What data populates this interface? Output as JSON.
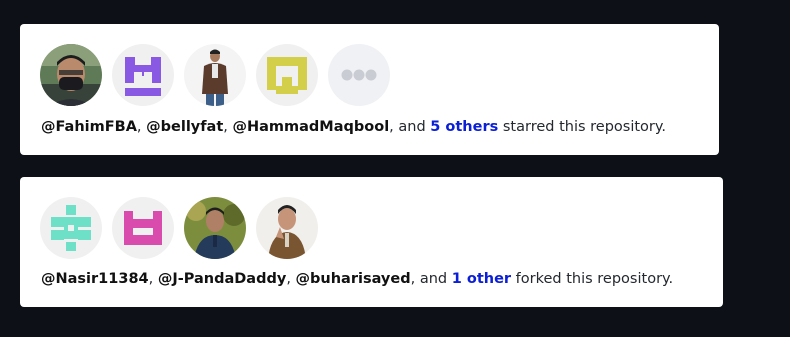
{
  "stargazers": {
    "users": [
      "@FahimFBA",
      "@bellyfat",
      "@HammadMaqbool"
    ],
    "sep1": ", ",
    "sep2": ", ",
    "and_word": ", and ",
    "others_link": "5 others",
    "suffix": " starred this repository.",
    "avatars": [
      {
        "name": "FahimFBA",
        "kind": "photo"
      },
      {
        "name": "bellyfat",
        "kind": "identicon",
        "color": "#8a59e3"
      },
      {
        "name": "HammadMaqbool",
        "kind": "photo"
      },
      {
        "name": "yellow-identicon",
        "kind": "identicon",
        "color": "#d4cf4a"
      },
      {
        "name": "more",
        "kind": "more-icon"
      }
    ]
  },
  "forkers": {
    "users": [
      "@Nasir11384",
      "@J-PandaDaddy",
      "@buharisayed"
    ],
    "sep1": ", ",
    "sep2": ", ",
    "and_word": ", and ",
    "others_link": "1 other",
    "suffix": " forked this repository.",
    "avatars": [
      {
        "name": "Nasir11384",
        "kind": "identicon",
        "color": "#6fe0c8"
      },
      {
        "name": "J-PandaDaddy",
        "kind": "identicon",
        "color": "#d94bac"
      },
      {
        "name": "buharisayed",
        "kind": "photo"
      },
      {
        "name": "fork-user-4",
        "kind": "photo"
      }
    ]
  },
  "colors": {
    "page_bg": "#0d1117",
    "card_bg": "#ffffff",
    "link": "#0b1fd6"
  }
}
